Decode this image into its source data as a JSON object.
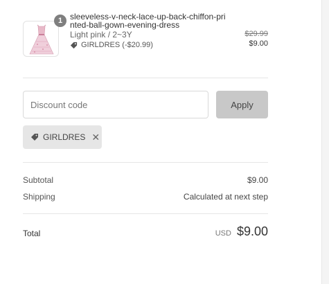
{
  "product": {
    "quantity": "1",
    "name": "sleeveless-v-neck-lace-up-back-chiffon-printed-ball-gown-evening-dress",
    "variant": "Light pink / 2~3Y",
    "discount": "GIRLDRES (-$20.99)",
    "original_price": "$29.99",
    "price": "$9.00",
    "image_icon": "pink-dress-image"
  },
  "discount": {
    "placeholder": "Discount code",
    "apply_label": "Apply",
    "applied_code": "GIRLDRES",
    "remove_icon": "close-icon"
  },
  "summary": {
    "subtotal_label": "Subtotal",
    "subtotal_value": "$9.00",
    "shipping_label": "Shipping",
    "shipping_value": "Calculated at next step",
    "total_label": "Total",
    "currency": "USD",
    "total_value": "$9.00"
  },
  "colors": {
    "badge": "#7f7f7f",
    "apply_button": "#c8c8c8",
    "tag_background": "#e6e6e6",
    "dress": "#e8b9c8"
  }
}
